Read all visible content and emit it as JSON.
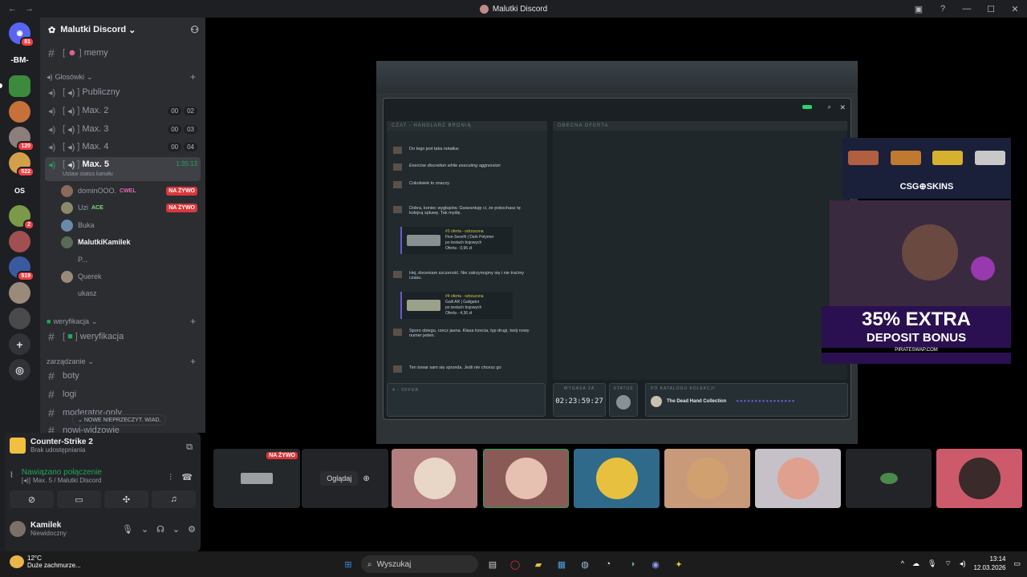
{
  "window": {
    "title": "Malutki Discord"
  },
  "guilds": {
    "home_badge": "81",
    "items": [
      {
        "text": "-BM-"
      },
      {
        "badge": "120"
      },
      {
        "badge": "522"
      },
      {
        "text": "OS"
      },
      {
        "badge": "2"
      },
      {
        "badge": "519"
      }
    ]
  },
  "server": {
    "name": "Malutki Discord",
    "channels": {
      "memy": "memy",
      "voice_category": "Głosówki",
      "voice": [
        {
          "name": "Publiczny"
        },
        {
          "name": "Max. 2",
          "a": "00",
          "b": "02"
        },
        {
          "name": "Max. 3",
          "a": "00",
          "b": "03"
        },
        {
          "name": "Max. 4",
          "a": "00",
          "b": "04"
        },
        {
          "name": "Max. 5",
          "time": "1:35:13",
          "status": "Ustaw status kanału"
        }
      ],
      "users": [
        {
          "name": "dominOOO.",
          "tag": "CWEL",
          "live": "NA ŻYWO"
        },
        {
          "name": "Uzi",
          "tag": "ACE",
          "live": "NA ŻYWO"
        },
        {
          "name": "Buka"
        },
        {
          "name": "MalutkiKamilek"
        },
        {
          "name": "P..."
        },
        {
          "name": "Querek"
        },
        {
          "name": "ukasz"
        }
      ],
      "verify_category": "weryfikacja",
      "verify_channel": "weryfikacja",
      "manage_category": "zarządzanie",
      "manage": [
        "boty",
        "logi",
        "moderator-only",
        "nowi-widzowie"
      ]
    },
    "unread_label": "NOWE NIEPRZECZYT. WIAD."
  },
  "panel": {
    "game": "Counter-Strike 2",
    "game_sub": "Brak udostępniania",
    "connection": "Nawiązano połączenie",
    "connection_sub": "Max. 5 / Malutki Discord",
    "user": "Kamilek",
    "user_status": "Niewidoczny"
  },
  "cs": {
    "chat_header": "CZAT - HANDLARZ BRONIĄ",
    "offer_header": "OBECNA OFERTA",
    "messages": [
      "Do tego jest taka notatka:",
      "Exercise discretion while executing aggression",
      "Cokolwiek to znaczy.",
      "Dobra, koniec wygłupów. Gwarantuję ci, że pokochasz tę kolejną spluwę. Tak myślę.",
      "Hej, doceniam szczerość. Nie zatrzymujmy się i nie traćmy czasu.",
      "Sporo obiegu, rzecz jasna. Klasa trzecia, typ drugi, twój nowy numer jeden.",
      "Ten towar sam się sprzeda. Jeśli nie chcesz go"
    ],
    "offers": [
      {
        "status": "#3 oferta - odrzucona",
        "name": "Five-SeveN | Dark Polymer",
        "desc": "po testach bojowych",
        "price": "Oferta - 0,96 zł"
      },
      {
        "status": "#4 oferta - odrzucona",
        "name": "Galil AR | Galigator",
        "desc": "po testach bojowych",
        "price": "Oferta - 4,36 zł"
      }
    ],
    "expires_label": "WYGASA ZA",
    "expires_value": "02:23:59:27",
    "status_label": "STATUS",
    "catalog_label": "PO KATALOGU KOLEKCJI",
    "collection": "The Dead Hand Collection",
    "offer_footer": "4 - OFFER"
  },
  "ads": {
    "brand": "CSG⊕SKINS",
    "bonus_line1": "35% EXTRA",
    "bonus_line2": "DEPOSIT BONUS",
    "bonus_site": "PIRATESWAP.COM"
  },
  "tiles": {
    "live": "NA ŻYWO",
    "watch": "Oglądaj"
  },
  "taskbar": {
    "temp": "12°C",
    "weather": "Duże zachmurze...",
    "search": "Wyszukaj",
    "time": "13:14",
    "date": "12.03.2026"
  }
}
